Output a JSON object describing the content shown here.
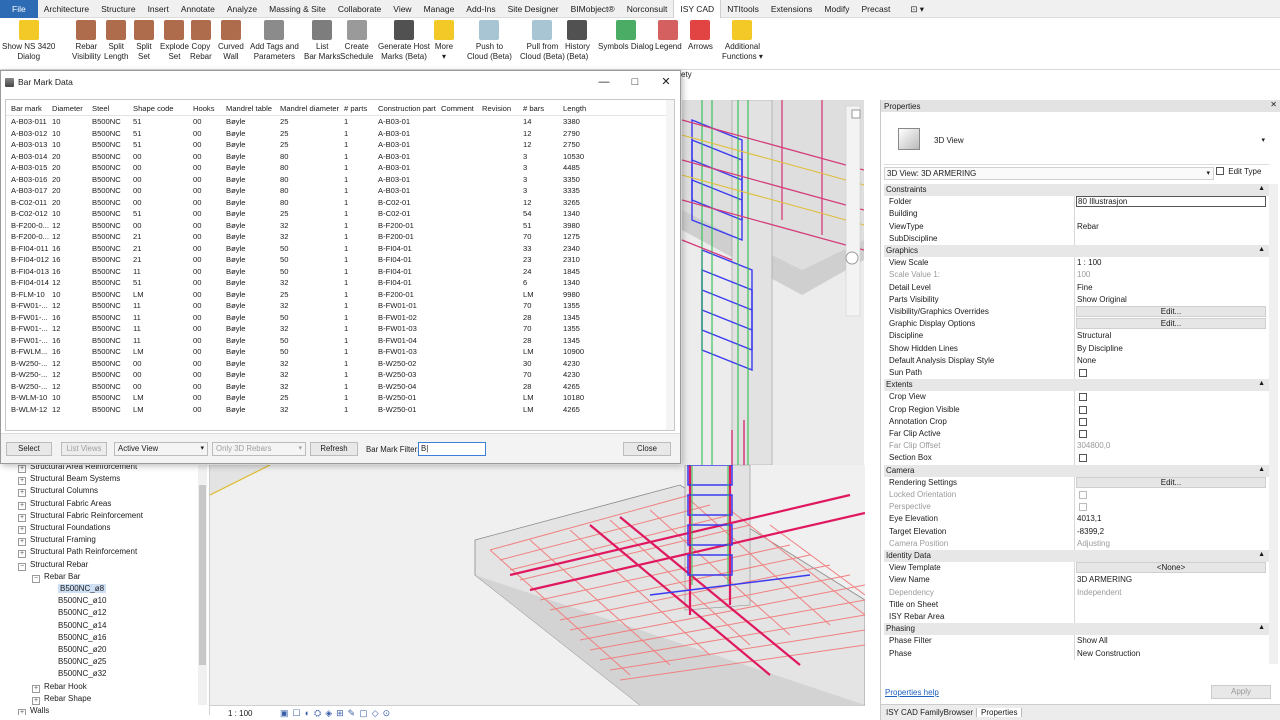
{
  "ribbon_tabs": [
    "File",
    "Architecture",
    "Structure",
    "Insert",
    "Annotate",
    "Analyze",
    "Massing & Site",
    "Collaborate",
    "View",
    "Manage",
    "Add-Ins",
    "Site Designer",
    "BIMobject®",
    "Norconsult",
    "ISY CAD",
    "NTItools",
    "Extensions",
    "Modify",
    "Precast"
  ],
  "ribbon_active_tab": "ISY CAD",
  "ribbon_buttons": [
    {
      "label1": "Show NS 3420",
      "label2": "Dialog",
      "icon": "arrows-icon"
    },
    {
      "label1": "Rebar",
      "label2": "Visibility",
      "icon": "rebar-icon"
    },
    {
      "label1": "Split",
      "label2": "Length",
      "icon": "split-icon"
    },
    {
      "label1": "Split",
      "label2": "Set",
      "icon": "split-set-icon"
    },
    {
      "label1": "Explode",
      "label2": "Set",
      "icon": "explode-icon"
    },
    {
      "label1": "Copy",
      "label2": "Rebar",
      "icon": "copy-icon"
    },
    {
      "label1": "Curved",
      "label2": "Wall",
      "icon": "curved-wall-icon"
    },
    {
      "label1": "Add Tags and",
      "label2": "Parameters",
      "icon": "tags-icon"
    },
    {
      "label1": "List",
      "label2": "Bar Marks",
      "icon": "list-icon"
    },
    {
      "label1": "Create",
      "label2": "Schedule",
      "icon": "schedule-icon"
    },
    {
      "label1": "Generate Host",
      "label2": "Marks (Beta)",
      "icon": "generate-icon"
    },
    {
      "label1": "More",
      "label2": "▾",
      "icon": "more-icon"
    },
    {
      "label1": "Push to",
      "label2": "Cloud (Beta)",
      "icon": "cloud-up-icon"
    },
    {
      "label1": "Pull from",
      "label2": "Cloud (Beta)",
      "icon": "cloud-down-icon"
    },
    {
      "label1": "History",
      "label2": "(Beta)",
      "icon": "history-icon"
    },
    {
      "label1": "Symbols Dialog",
      "label2": "",
      "icon": "symbols-icon"
    },
    {
      "label1": "Legend",
      "label2": "",
      "icon": "legend-icon"
    },
    {
      "label1": "Arrows",
      "label2": "",
      "icon": "arrows2-icon"
    },
    {
      "label1": "Additional",
      "label2": "Functions ▾",
      "icon": "functions-icon"
    }
  ],
  "ribbon_fragment": "ety",
  "dialog": {
    "title": "Bar Mark Data",
    "columns": [
      "Bar mark",
      "Diameter",
      "Steel",
      "Shape code",
      "Hooks",
      "Mandrel table",
      "Mandrel diameter",
      "# parts",
      "Construction part",
      "Comment",
      "Revision",
      "# bars",
      "Length"
    ],
    "rows": [
      [
        "A-B03-011",
        "10",
        "B500NC",
        "51",
        "00",
        "Bøyle",
        "25",
        "1",
        "A-B03-01",
        "",
        "",
        "14",
        "3380"
      ],
      [
        "A-B03-012",
        "10",
        "B500NC",
        "51",
        "00",
        "Bøyle",
        "25",
        "1",
        "A-B03-01",
        "",
        "",
        "12",
        "2790"
      ],
      [
        "A-B03-013",
        "10",
        "B500NC",
        "51",
        "00",
        "Bøyle",
        "25",
        "1",
        "A-B03-01",
        "",
        "",
        "12",
        "2750"
      ],
      [
        "A-B03-014",
        "20",
        "B500NC",
        "00",
        "00",
        "Bøyle",
        "80",
        "1",
        "A-B03-01",
        "",
        "",
        "3",
        "10530"
      ],
      [
        "A-B03-015",
        "20",
        "B500NC",
        "00",
        "00",
        "Bøyle",
        "80",
        "1",
        "A-B03-01",
        "",
        "",
        "3",
        "4485"
      ],
      [
        "A-B03-016",
        "20",
        "B500NC",
        "00",
        "00",
        "Bøyle",
        "80",
        "1",
        "A-B03-01",
        "",
        "",
        "3",
        "3350"
      ],
      [
        "A-B03-017",
        "20",
        "B500NC",
        "00",
        "00",
        "Bøyle",
        "80",
        "1",
        "A-B03-01",
        "",
        "",
        "3",
        "3335"
      ],
      [
        "B-C02-011",
        "20",
        "B500NC",
        "00",
        "00",
        "Bøyle",
        "80",
        "1",
        "B-C02-01",
        "",
        "",
        "12",
        "3265"
      ],
      [
        "B-C02-012",
        "10",
        "B500NC",
        "51",
        "00",
        "Bøyle",
        "25",
        "1",
        "B-C02-01",
        "",
        "",
        "54",
        "1340"
      ],
      [
        "B-F200-0...",
        "12",
        "B500NC",
        "00",
        "00",
        "Bøyle",
        "32",
        "1",
        "B-F200-01",
        "",
        "",
        "51",
        "3980"
      ],
      [
        "B-F200-0...",
        "12",
        "B500NC",
        "21",
        "00",
        "Bøyle",
        "32",
        "1",
        "B-F200-01",
        "",
        "",
        "70",
        "1275"
      ],
      [
        "B-FI04-011",
        "16",
        "B500NC",
        "21",
        "00",
        "Bøyle",
        "50",
        "1",
        "B-FI04-01",
        "",
        "",
        "33",
        "2340"
      ],
      [
        "B-FI04-012",
        "16",
        "B500NC",
        "21",
        "00",
        "Bøyle",
        "50",
        "1",
        "B-FI04-01",
        "",
        "",
        "23",
        "2310"
      ],
      [
        "B-FI04-013",
        "16",
        "B500NC",
        "11",
        "00",
        "Bøyle",
        "50",
        "1",
        "B-FI04-01",
        "",
        "",
        "24",
        "1845"
      ],
      [
        "B-FI04-014",
        "12",
        "B500NC",
        "51",
        "00",
        "Bøyle",
        "32",
        "1",
        "B-FI04-01",
        "",
        "",
        "6",
        "1340"
      ],
      [
        "B-FLM-10",
        "10",
        "B500NC",
        "LM",
        "00",
        "Bøyle",
        "25",
        "1",
        "B-F200-01",
        "",
        "",
        "LM",
        "9980"
      ],
      [
        "B-FW01-...",
        "12",
        "B500NC",
        "11",
        "00",
        "Bøyle",
        "32",
        "1",
        "B-FW01-01",
        "",
        "",
        "70",
        "1355"
      ],
      [
        "B-FW01-...",
        "16",
        "B500NC",
        "11",
        "00",
        "Bøyle",
        "50",
        "1",
        "B-FW01-02",
        "",
        "",
        "28",
        "1345"
      ],
      [
        "B-FW01-...",
        "12",
        "B500NC",
        "11",
        "00",
        "Bøyle",
        "32",
        "1",
        "B-FW01-03",
        "",
        "",
        "70",
        "1355"
      ],
      [
        "B-FW01-...",
        "16",
        "B500NC",
        "11",
        "00",
        "Bøyle",
        "50",
        "1",
        "B-FW01-04",
        "",
        "",
        "28",
        "1345"
      ],
      [
        "B-FWLM...",
        "16",
        "B500NC",
        "LM",
        "00",
        "Bøyle",
        "50",
        "1",
        "B-FW01-03",
        "",
        "",
        "LM",
        "10900"
      ],
      [
        "B-W250-...",
        "12",
        "B500NC",
        "00",
        "00",
        "Bøyle",
        "32",
        "1",
        "B-W250-02",
        "",
        "",
        "30",
        "4230"
      ],
      [
        "B-W250-...",
        "12",
        "B500NC",
        "00",
        "00",
        "Bøyle",
        "32",
        "1",
        "B-W250-03",
        "",
        "",
        "70",
        "4230"
      ],
      [
        "B-W250-...",
        "12",
        "B500NC",
        "00",
        "00",
        "Bøyle",
        "32",
        "1",
        "B-W250-04",
        "",
        "",
        "28",
        "4265"
      ],
      [
        "B-WLM-10",
        "10",
        "B500NC",
        "LM",
        "00",
        "Bøyle",
        "25",
        "1",
        "B-W250-01",
        "",
        "",
        "LM",
        "10180"
      ],
      [
        "B-WLM-12",
        "12",
        "B500NC",
        "LM",
        "00",
        "Bøyle",
        "32",
        "1",
        "B-W250-01",
        "",
        "",
        "LM",
        "4265"
      ]
    ],
    "footer": {
      "select": "Select",
      "list_views": "List Views",
      "view_select": "Active View",
      "only3d": "Only 3D Rebars",
      "refresh": "Refresh",
      "filter_label": "Bar Mark Filter:",
      "filter_value": "B|",
      "close": "Close"
    }
  },
  "browser": {
    "items": [
      {
        "label": "Structural Area Reinforcement",
        "level": 1,
        "pm": "+"
      },
      {
        "label": "Structural Beam Systems",
        "level": 1,
        "pm": "+"
      },
      {
        "label": "Structural Columns",
        "level": 1,
        "pm": "+"
      },
      {
        "label": "Structural Fabric Areas",
        "level": 1,
        "pm": "+"
      },
      {
        "label": "Structural Fabric Reinforcement",
        "level": 1,
        "pm": "+"
      },
      {
        "label": "Structural Foundations",
        "level": 1,
        "pm": "+"
      },
      {
        "label": "Structural Framing",
        "level": 1,
        "pm": "+"
      },
      {
        "label": "Structural Path Reinforcement",
        "level": 1,
        "pm": "+"
      },
      {
        "label": "Structural Rebar",
        "level": 1,
        "pm": "−"
      },
      {
        "label": "Rebar Bar",
        "level": 2,
        "pm": "−"
      },
      {
        "label": "B500NC_ø8",
        "level": 3,
        "pm": "",
        "selected": true
      },
      {
        "label": "B500NC_ø10",
        "level": 3,
        "pm": ""
      },
      {
        "label": "B500NC_ø12",
        "level": 3,
        "pm": ""
      },
      {
        "label": "B500NC_ø14",
        "level": 3,
        "pm": ""
      },
      {
        "label": "B500NC_ø16",
        "level": 3,
        "pm": ""
      },
      {
        "label": "B500NC_ø20",
        "level": 3,
        "pm": ""
      },
      {
        "label": "B500NC_ø25",
        "level": 3,
        "pm": ""
      },
      {
        "label": "B500NC_ø32",
        "level": 3,
        "pm": ""
      },
      {
        "label": "Rebar Hook",
        "level": 2,
        "pm": "+"
      },
      {
        "label": "Rebar Shape",
        "level": 2,
        "pm": "+"
      },
      {
        "label": "Walls",
        "level": 1,
        "pm": "+"
      }
    ]
  },
  "statusbar": {
    "scale": "1 : 100"
  },
  "properties": {
    "title": "Properties",
    "type_name": "3D View",
    "view_selector": "3D View: 3D ARMERING",
    "edit_type": "Edit Type",
    "rows": [
      {
        "kind": "sec",
        "k": "Constraints"
      },
      {
        "k": "Folder",
        "v": "80 Illustrasjon",
        "box": true
      },
      {
        "k": "Building",
        "v": ""
      },
      {
        "k": "ViewType",
        "v": "Rebar"
      },
      {
        "k": "SubDiscipline",
        "v": ""
      },
      {
        "kind": "sec",
        "k": "Graphics"
      },
      {
        "k": "View Scale",
        "v": "1 : 100"
      },
      {
        "k": "Scale Value  1:",
        "v": "100",
        "grey": true
      },
      {
        "k": "Detail Level",
        "v": "Fine"
      },
      {
        "k": "Parts Visibility",
        "v": "Show Original"
      },
      {
        "k": "Visibility/Graphics Overrides",
        "v": "Edit...",
        "btn": true
      },
      {
        "k": "Graphic Display Options",
        "v": "Edit...",
        "btn": true
      },
      {
        "k": "Discipline",
        "v": "Structural"
      },
      {
        "k": "Show Hidden Lines",
        "v": "By Discipline"
      },
      {
        "k": "Default Analysis Display Style",
        "v": "None"
      },
      {
        "k": "Sun Path",
        "v": "",
        "check": true
      },
      {
        "kind": "sec",
        "k": "Extents"
      },
      {
        "k": "Crop View",
        "v": "",
        "check": true
      },
      {
        "k": "Crop Region Visible",
        "v": "",
        "check": true
      },
      {
        "k": "Annotation Crop",
        "v": "",
        "check": true
      },
      {
        "k": "Far Clip Active",
        "v": "",
        "check": true
      },
      {
        "k": "Far Clip Offset",
        "v": "304800,0",
        "grey": true
      },
      {
        "k": "Section Box",
        "v": "",
        "check": true
      },
      {
        "kind": "sec",
        "k": "Camera"
      },
      {
        "k": "Rendering Settings",
        "v": "Edit...",
        "btn": true
      },
      {
        "k": "Locked Orientation",
        "v": "",
        "check": true,
        "grey": true
      },
      {
        "k": "Perspective",
        "v": "",
        "check": true,
        "grey": true
      },
      {
        "k": "Eye Elevation",
        "v": "4013,1"
      },
      {
        "k": "Target Elevation",
        "v": "-8399,2"
      },
      {
        "k": "Camera Position",
        "v": "Adjusting",
        "grey": true
      },
      {
        "kind": "sec",
        "k": "Identity Data"
      },
      {
        "k": "View Template",
        "v": "<None>",
        "btn": true
      },
      {
        "k": "View Name",
        "v": "3D ARMERING"
      },
      {
        "k": "Dependency",
        "v": "Independent",
        "grey": true
      },
      {
        "k": "Title on Sheet",
        "v": ""
      },
      {
        "k": "ISY Rebar Area",
        "v": ""
      },
      {
        "kind": "sec",
        "k": "Phasing"
      },
      {
        "k": "Phase Filter",
        "v": "Show All"
      },
      {
        "k": "Phase",
        "v": "New Construction"
      }
    ],
    "help": "Properties help",
    "apply": "Apply",
    "bottom_tabs": [
      "ISY CAD FamilyBrowser",
      "Properties"
    ]
  }
}
